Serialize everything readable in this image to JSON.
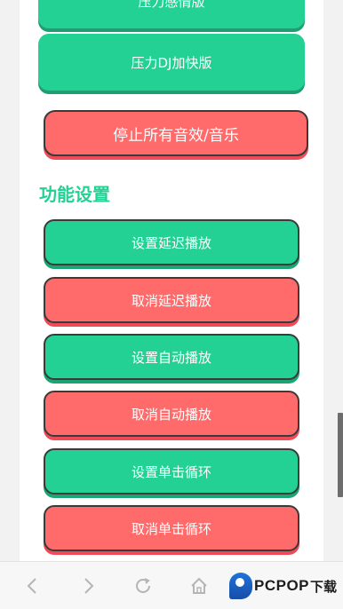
{
  "buttons": {
    "top_partial": "压力感情版",
    "dj_fast": "压力DJ加快版",
    "stop_all": "停止所有音效/音乐"
  },
  "section": {
    "title": "功能设置"
  },
  "settings": [
    {
      "label": "设置延迟播放",
      "color": "green"
    },
    {
      "label": "取消延迟播放",
      "color": "red"
    },
    {
      "label": "设置自动播放",
      "color": "green"
    },
    {
      "label": "取消自动播放",
      "color": "red"
    },
    {
      "label": "设置单击循环",
      "color": "green"
    },
    {
      "label": "取消单击循环",
      "color": "red"
    }
  ],
  "navbar": {
    "icons": [
      "back-icon",
      "forward-icon",
      "refresh-icon",
      "home-icon"
    ],
    "brand_text": "PCPOP",
    "brand_sub": "下载"
  },
  "colors": {
    "green": "#24d194",
    "red": "#ff6b6b",
    "title_green": "#24d194"
  }
}
